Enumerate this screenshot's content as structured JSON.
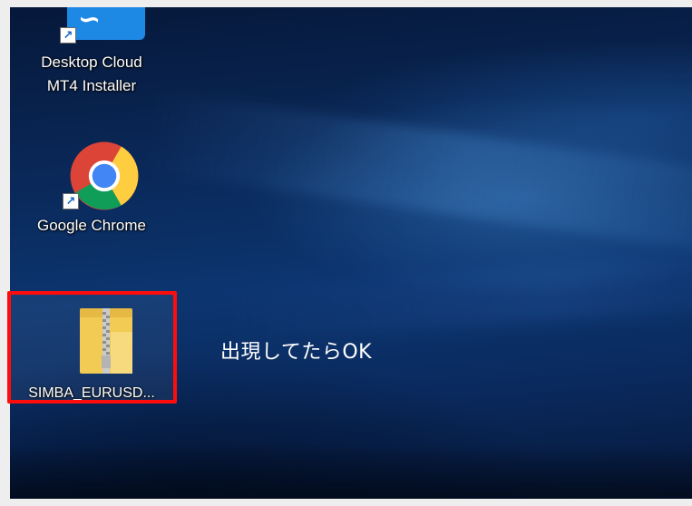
{
  "desktop": {
    "icons": [
      {
        "label_line1": "Desktop Cloud",
        "label_line2": "MT4 Installer",
        "icon": "desktop-cloud-installer-icon"
      },
      {
        "label_line1": "Google Chrome",
        "icon": "chrome-icon"
      },
      {
        "label_line1": "SIMBA_EURUSD...",
        "icon": "zip-folder-icon"
      }
    ]
  },
  "annotation": {
    "text": "出現してたらOK",
    "highlight_color": "#ff0d0d"
  }
}
